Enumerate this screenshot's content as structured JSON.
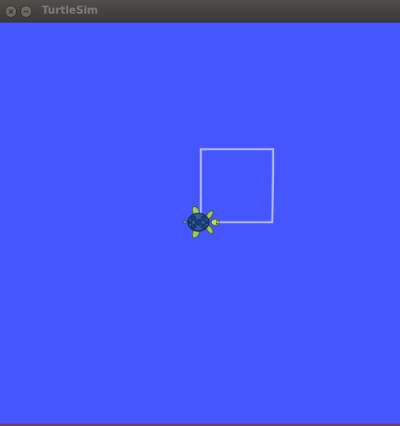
{
  "window": {
    "title": "TurtleSim"
  },
  "titlebar_buttons": [
    {
      "name": "close",
      "icon": "close-icon"
    },
    {
      "name": "minimize",
      "icon": "minimize-icon"
    }
  ],
  "canvas": {
    "background_color": "#4556ff",
    "pen_color": "#b3b8ff",
    "turtle_icon": "turtle-icon"
  }
}
